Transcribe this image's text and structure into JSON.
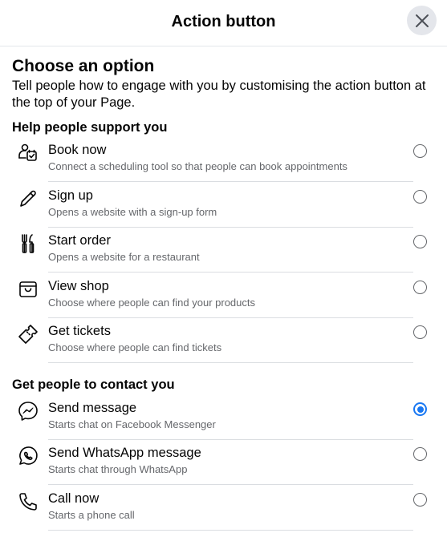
{
  "header": {
    "title": "Action button",
    "close_icon": "close-icon"
  },
  "main": {
    "title": "Choose an option",
    "description": "Tell people how to engage with you by customising the action button at the top of your Page."
  },
  "groups": [
    {
      "heading": "Help people support you",
      "options": [
        {
          "label": "Book now",
          "sublabel": "Connect a scheduling tool so that people can book appointments",
          "icon": "calendar-person-icon",
          "selected": false
        },
        {
          "label": "Sign up",
          "sublabel": "Opens a website with a sign-up form",
          "icon": "pencil-icon",
          "selected": false
        },
        {
          "label": "Start order",
          "sublabel": "Opens a website for a restaurant",
          "icon": "fork-knife-icon",
          "selected": false
        },
        {
          "label": "View shop",
          "sublabel": "Choose where people can find your products",
          "icon": "shop-bag-icon",
          "selected": false
        },
        {
          "label": "Get tickets",
          "sublabel": "Choose where people can find tickets",
          "icon": "ticket-icon",
          "selected": false
        }
      ]
    },
    {
      "heading": "Get people to contact you",
      "options": [
        {
          "label": "Send message",
          "sublabel": "Starts chat on Facebook Messenger",
          "icon": "messenger-icon",
          "selected": true
        },
        {
          "label": "Send WhatsApp message",
          "sublabel": "Starts chat through WhatsApp",
          "icon": "whatsapp-icon",
          "selected": false
        },
        {
          "label": "Call now",
          "sublabel": "Starts a phone call",
          "icon": "phone-icon",
          "selected": false
        }
      ]
    }
  ],
  "colors": {
    "accent": "#1877f2",
    "secondary_text": "#65676b",
    "divider": "#dadde1"
  }
}
